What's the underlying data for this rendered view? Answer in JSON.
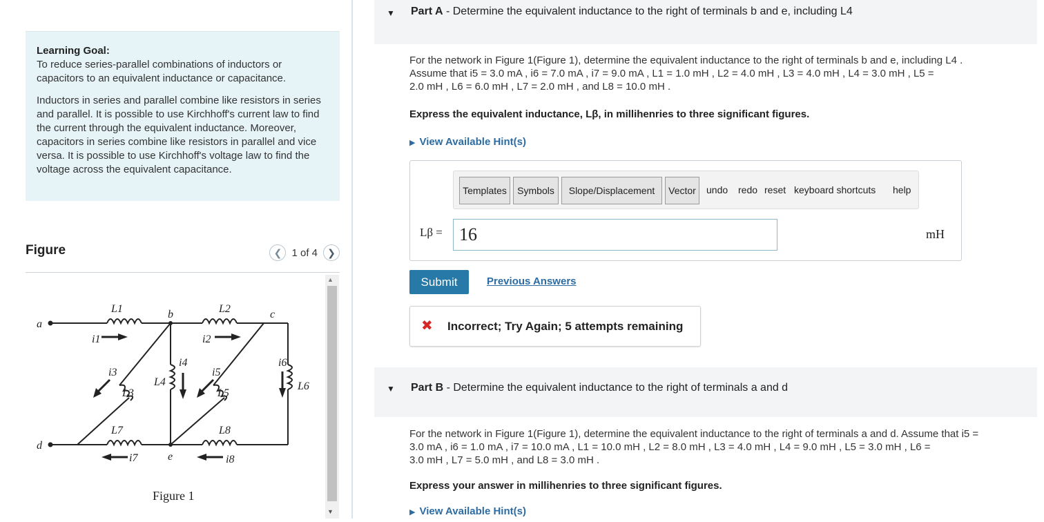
{
  "learning_goal": {
    "title": "Learning Goal:",
    "text1": "To reduce series-parallel combinations of inductors or capacitors to an equivalent inductance or capacitance.",
    "text2": "Inductors in series and parallel combine like resistors in series and parallel.  It is possible to use Kirchhoff's current law to find the current through the equivalent inductance.  Moreover, capacitors in series combine like resistors in parallel and vice versa.  It is possible to use Kirchhoff's voltage law to find the voltage across the equivalent capacitance."
  },
  "figure": {
    "title": "Figure",
    "pager": "1 of 4",
    "caption": "Figure 1",
    "labels": {
      "a": "a",
      "b": "b",
      "c": "c",
      "d": "d",
      "e": "e",
      "L1": "L1",
      "L2": "L2",
      "L3": "L3",
      "L4": "L4",
      "L5": "L5",
      "L6": "L6",
      "L7": "L7",
      "L8": "L8",
      "i1": "i1",
      "i2": "i2",
      "i3": "i3",
      "i4": "i4",
      "i5": "i5",
      "i6": "i6",
      "i7": "i7",
      "i8": "i8"
    }
  },
  "partA": {
    "label": "Part A",
    "title": "Determine the equivalent inductance to the right of terminals b and e, including L4",
    "body_line1": "For the network in Figure 1(Figure 1), determine the equivalent inductance to the right of terminals b and e, including L4 .",
    "body_line2": "Assume that i5 = 3.0 mA , i6 = 7.0 mA , i7 = 9.0 mA , L1 = 1.0 mH , L2 = 4.0 mH , L3 = 4.0 mH , L4 = 3.0 mH , L5 =",
    "body_line3": "2.0 mH , L6 = 6.0 mH , L7 = 2.0 mH , and L8 = 10.0 mH .",
    "figure_link": "Figure 1",
    "express": "Express the equivalent inductance, Lβ, in millihenries to three significant figures.",
    "hint": "View Available Hint(s)",
    "toolbar": [
      "Templates",
      "Symbols",
      "Slope/Displacement",
      "Vector",
      "undo",
      "redo",
      "reset",
      "keyboard shortcuts",
      "help"
    ],
    "eq_label": "Lβ =",
    "answer_value": "16",
    "unit": "mH",
    "submit": "Submit",
    "previous": "Previous Answers",
    "feedback": "Incorrect; Try Again; 5 attempts remaining"
  },
  "partB": {
    "label": "Part B",
    "title": "Determine the equivalent inductance to the right of terminals a and d",
    "body_line1": "For the network in Figure 1(Figure 1), determine the equivalent inductance to the right of terminals a and d. Assume that i5 =",
    "body_line2": "3.0 mA , i6 = 1.0 mA , i7 = 10.0 mA , L1 = 10.0 mH , L2 = 8.0 mH , L3 = 4.0 mH , L4 = 9.0 mH , L5 = 3.0 mH , L6 =",
    "body_line3": "3.0 mH , L7 = 5.0 mH , and L8 = 3.0 mH .",
    "express": "Express your answer in millihenries to three significant figures.",
    "hint": "View Available Hint(s)"
  }
}
